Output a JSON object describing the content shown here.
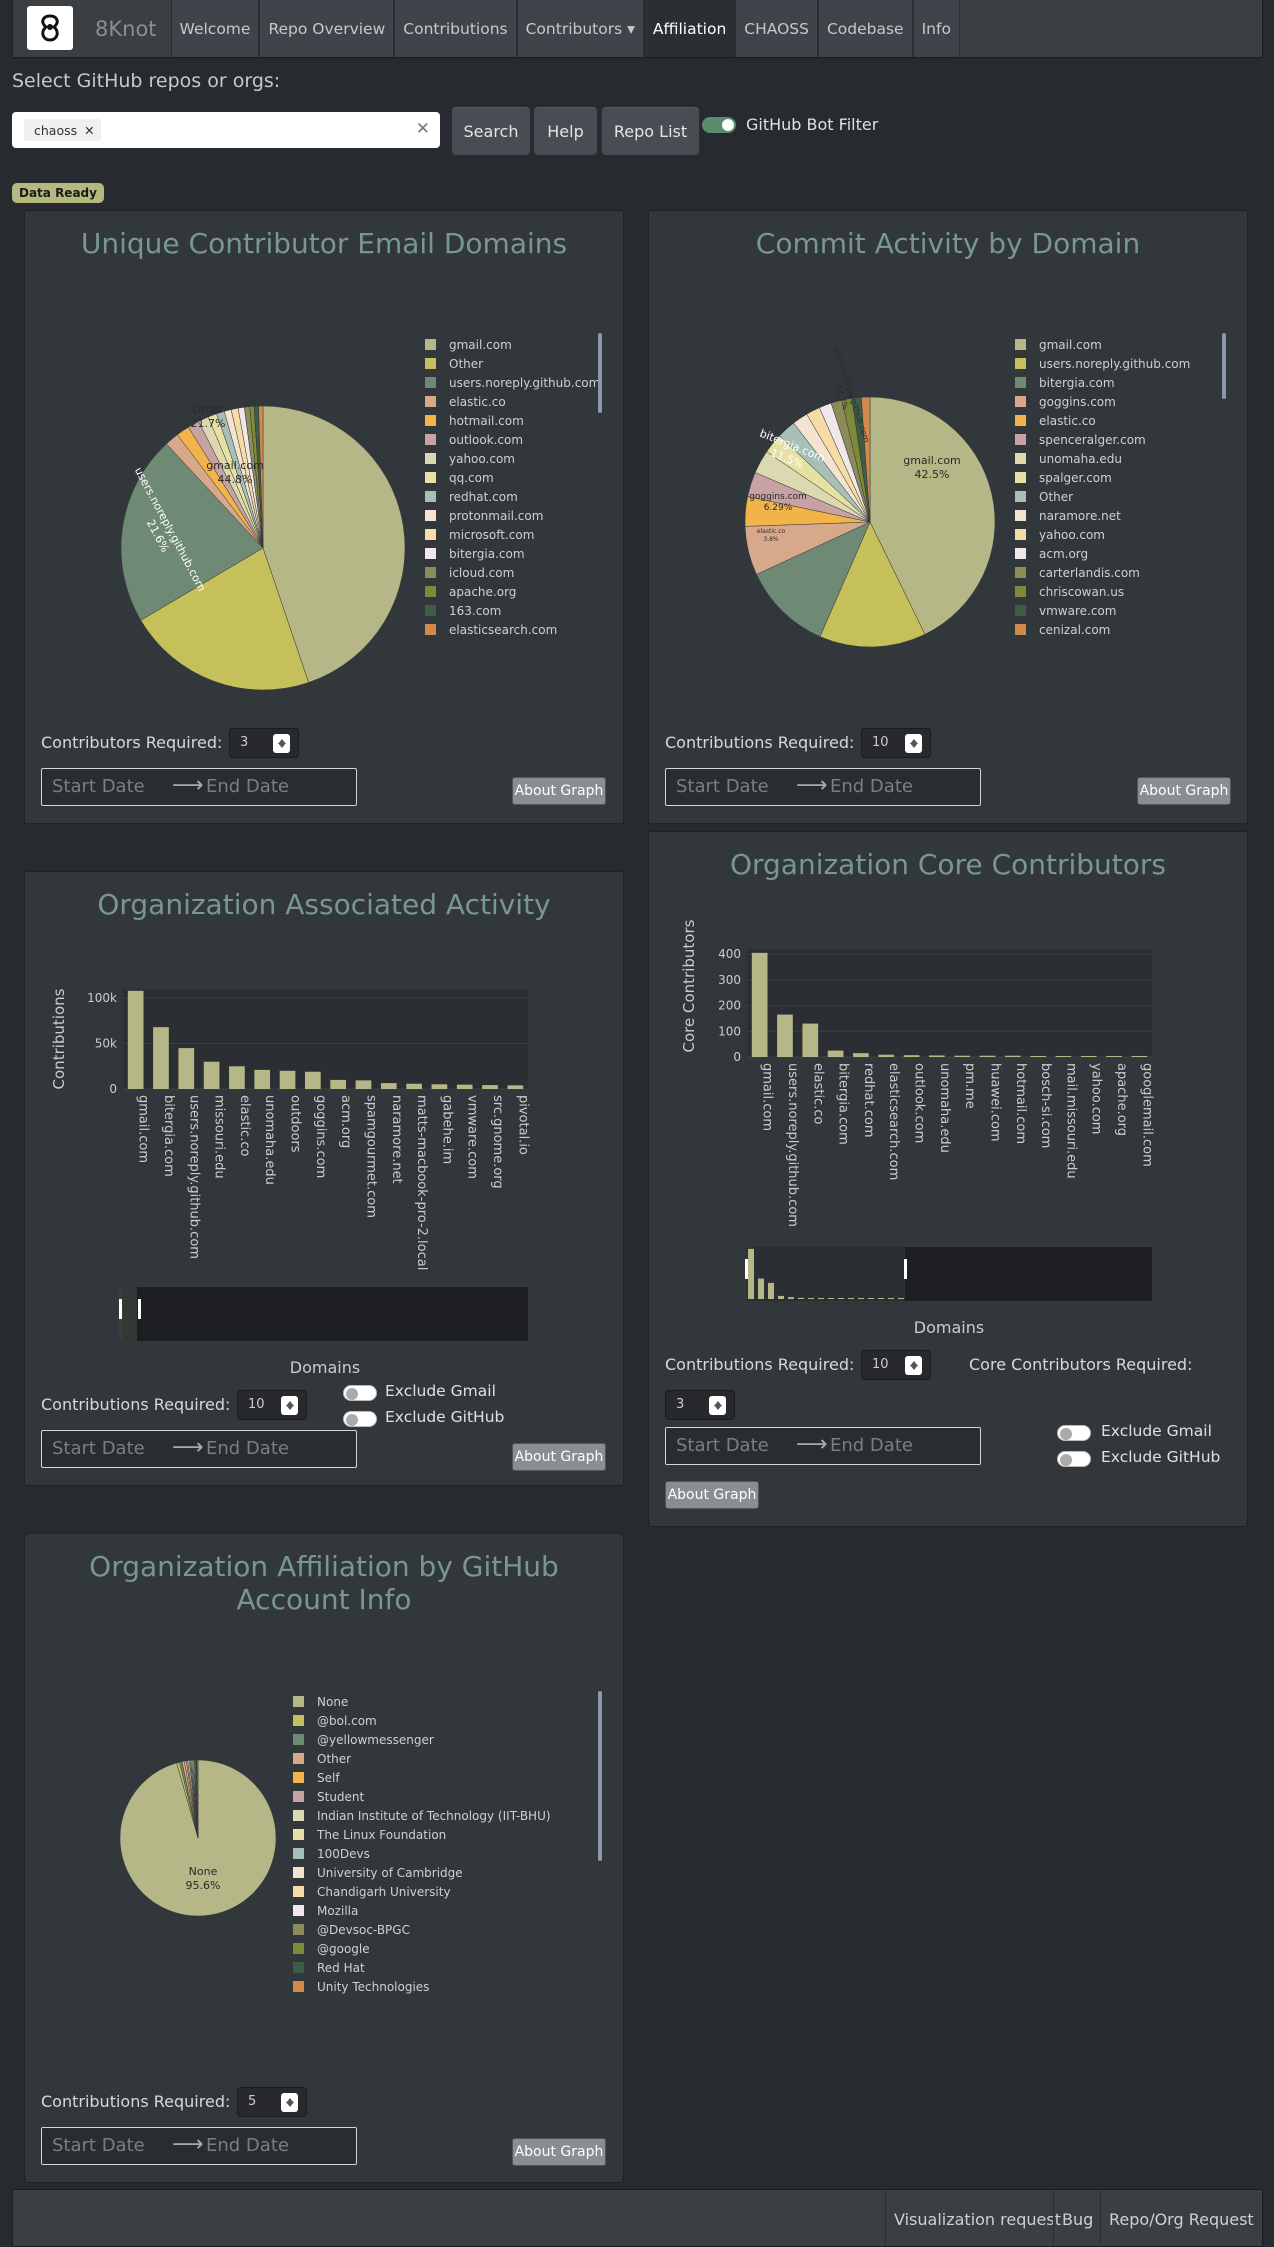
{
  "nav": {
    "brand": "8Knot",
    "items": [
      {
        "label": "Welcome",
        "active": false
      },
      {
        "label": "Repo Overview",
        "active": false
      },
      {
        "label": "Contributions",
        "active": false
      },
      {
        "label": "Contributors ▾",
        "active": false
      },
      {
        "label": "Affiliation",
        "active": true
      },
      {
        "label": "CHAOSS",
        "active": false
      },
      {
        "label": "Codebase",
        "active": false
      },
      {
        "label": "Info",
        "active": false
      }
    ]
  },
  "search": {
    "prompt": "Select GitHub repos or orgs:",
    "chips": [
      "chaoss"
    ],
    "search_label": "Search",
    "help_label": "Help",
    "repo_list_label": "Repo List",
    "bot_filter_label": "GitHub Bot Filter",
    "bot_filter_on": true
  },
  "status_badge": "Data Ready",
  "date_picker": {
    "start_placeholder": "Start Date",
    "end_placeholder": "End Date"
  },
  "about_label": "About Graph",
  "exclude_gmail_label": "Exclude Gmail",
  "exclude_github_label": "Exclude GitHub",
  "cards": {
    "email_domains": {
      "title": "Unique Contributor Email Domains",
      "field_label": "Contributors Required:",
      "field_value": "3",
      "legend": [
        "gmail.com",
        "Other",
        "users.noreply.github.com",
        "elastic.co",
        "hotmail.com",
        "outlook.com",
        "yahoo.com",
        "qq.com",
        "redhat.com",
        "protonmail.com",
        "microsoft.com",
        "bitergia.com",
        "icloud.com",
        "apache.org",
        "163.com",
        "elasticsearch.com"
      ],
      "slice_labels": [
        [
          "gmail.com",
          "44.8%"
        ],
        [
          "Other",
          "21.7%"
        ],
        [
          "users.noreply.github.com",
          "21.6%"
        ]
      ]
    },
    "commit_activity": {
      "title": "Commit Activity by Domain",
      "field_label": "Contributions Required:",
      "field_value": "10",
      "legend": [
        "gmail.com",
        "users.noreply.github.com",
        "bitergia.com",
        "goggins.com",
        "elastic.co",
        "spenceralger.com",
        "unomaha.edu",
        "spalger.com",
        "Other",
        "naramore.net",
        "yahoo.com",
        "acm.org",
        "carterlandis.com",
        "chriscowan.us",
        "vmware.com",
        "cenizal.com"
      ],
      "slice_labels": [
        [
          "gmail.com",
          "42.5%"
        ],
        [
          "users.noreply.github.com",
          "13.7%"
        ],
        [
          "bitergia.com",
          "11.5%"
        ],
        [
          "goggins.com",
          "6.29%"
        ],
        [
          "elastic.co",
          "3.8%"
        ]
      ]
    },
    "org_activity": {
      "title": "Organization Associated Activity",
      "field_label": "Contributions Required:",
      "field_value": "10",
      "xlabel": "Domains",
      "ylabel": "Contributions",
      "exclude_gmail": false,
      "exclude_github": false
    },
    "core_contributors": {
      "title": "Organization Core Contributors",
      "field_label": "Contributions Required:",
      "field_value": "10",
      "core_label": "Core Contributors Required:",
      "core_value": "3",
      "xlabel": "Domains",
      "ylabel": "Core Contributors",
      "exclude_gmail": false,
      "exclude_github": false
    },
    "account_affiliation": {
      "title": "Organization Affiliation by GitHub Account Info",
      "field_label": "Contributions Required:",
      "field_value": "5",
      "legend": [
        "None",
        "@bol.com",
        "@yellowmessenger",
        "Other",
        "Self",
        "Student",
        "Indian Institute of Technology (IIT-BHU)",
        "The Linux Foundation",
        "100Devs",
        "University of Cambridge",
        "Chandigarh University",
        "Mozilla",
        "@Devsoc-BPGC",
        "@google",
        "Red Hat",
        "Unity Technologies"
      ],
      "slice_labels": [
        [
          "None",
          "95.6%"
        ]
      ]
    }
  },
  "palette": [
    "#b5b786",
    "#c6c05a",
    "#6e8a74",
    "#d7a98a",
    "#f2b34a",
    "#c7a2a2",
    "#dcd8b0",
    "#e6e0a2",
    "#a7bfb6",
    "#f3e3d0",
    "#f6dca4",
    "#f1e6e8",
    "#8c8c58",
    "#7f8a38",
    "#3e5c46",
    "#d18a4c"
  ],
  "chart_data": [
    {
      "type": "pie",
      "title": "Unique Contributor Email Domains",
      "labels": [
        "gmail.com",
        "Other",
        "users.noreply.github.com",
        "elastic.co",
        "hotmail.com",
        "outlook.com",
        "yahoo.com",
        "qq.com",
        "redhat.com",
        "protonmail.com",
        "microsoft.com",
        "bitergia.com",
        "icloud.com",
        "apache.org",
        "163.com",
        "elasticsearch.com"
      ],
      "values": [
        44.8,
        21.7,
        21.6,
        1.6,
        1.5,
        1.3,
        1.2,
        1.0,
        0.9,
        0.8,
        0.8,
        0.7,
        0.6,
        0.5,
        0.5,
        0.5
      ]
    },
    {
      "type": "pie",
      "title": "Commit Activity by Domain",
      "labels": [
        "gmail.com",
        "users.noreply.github.com",
        "bitergia.com",
        "goggins.com",
        "elastic.co",
        "spenceralger.com",
        "unomaha.edu",
        "spalger.com",
        "Other",
        "naramore.net",
        "yahoo.com",
        "acm.org",
        "carterlandis.com",
        "chriscowan.us",
        "vmware.com",
        "cenizal.com"
      ],
      "values": [
        42.5,
        13.7,
        11.5,
        6.29,
        3.8,
        3.2,
        3.0,
        2.6,
        2.4,
        2.0,
        1.8,
        1.6,
        1.4,
        1.3,
        1.2,
        1.1
      ]
    },
    {
      "type": "bar",
      "title": "Organization Associated Activity",
      "categories": [
        "gmail.com",
        "bitergia.com",
        "users.noreply.github.com",
        "missouri.edu",
        "elastic.co",
        "unomaha.edu",
        "outdoors",
        "goggins.com",
        "acm.org",
        "spamgourmet.com",
        "naramore.net",
        "matts-macbook-pro-2.local",
        "gabehe.im",
        "vmware.com",
        "src.gnome.org",
        "pivotal.io"
      ],
      "values": [
        108000,
        68000,
        45000,
        30000,
        25000,
        21000,
        20000,
        19000,
        10000,
        9500,
        6500,
        5800,
        5200,
        4800,
        4300,
        4000
      ],
      "ylabel": "Contributions",
      "xlabel": "Domains",
      "yticks": [
        "0",
        "50k",
        "100k"
      ],
      "ylim": [
        0,
        110000
      ]
    },
    {
      "type": "bar",
      "title": "Organization Core Contributors",
      "categories": [
        "gmail.com",
        "users.noreply.github.com",
        "elastic.co",
        "bitergia.com",
        "redhat.com",
        "elasticsearch.com",
        "outlook.com",
        "unomaha.edu",
        "pm.me",
        "huawei.com",
        "hotmail.com",
        "bosch-si.com",
        "mail.missouri.edu",
        "yahoo.com",
        "apache.org",
        "googlemail.com"
      ],
      "values": [
        405,
        165,
        130,
        25,
        15,
        9,
        7,
        6,
        5,
        5,
        5,
        4,
        4,
        4,
        4,
        4
      ],
      "ylabel": "Core Contributors",
      "xlabel": "Domains",
      "yticks": [
        "0",
        "100",
        "200",
        "300",
        "400"
      ],
      "ylim": [
        0,
        420
      ]
    },
    {
      "type": "pie",
      "title": "Organization Affiliation by GitHub Account Info",
      "labels": [
        "None",
        "@bol.com",
        "@yellowmessenger",
        "Other",
        "Self",
        "Student",
        "Indian Institute of Technology (IIT-BHU)",
        "The Linux Foundation",
        "100Devs",
        "University of Cambridge",
        "Chandigarh University",
        "Mozilla",
        "@Devsoc-BPGC",
        "@google",
        "Red Hat",
        "Unity Technologies"
      ],
      "values": [
        95.6,
        0.6,
        0.5,
        0.5,
        0.4,
        0.3,
        0.3,
        0.2,
        0.2,
        0.2,
        0.2,
        0.2,
        0.2,
        0.2,
        0.2,
        0.2
      ]
    }
  ],
  "footer": {
    "links": [
      "Visualization request",
      "Bug",
      "Repo/Org Request"
    ]
  }
}
